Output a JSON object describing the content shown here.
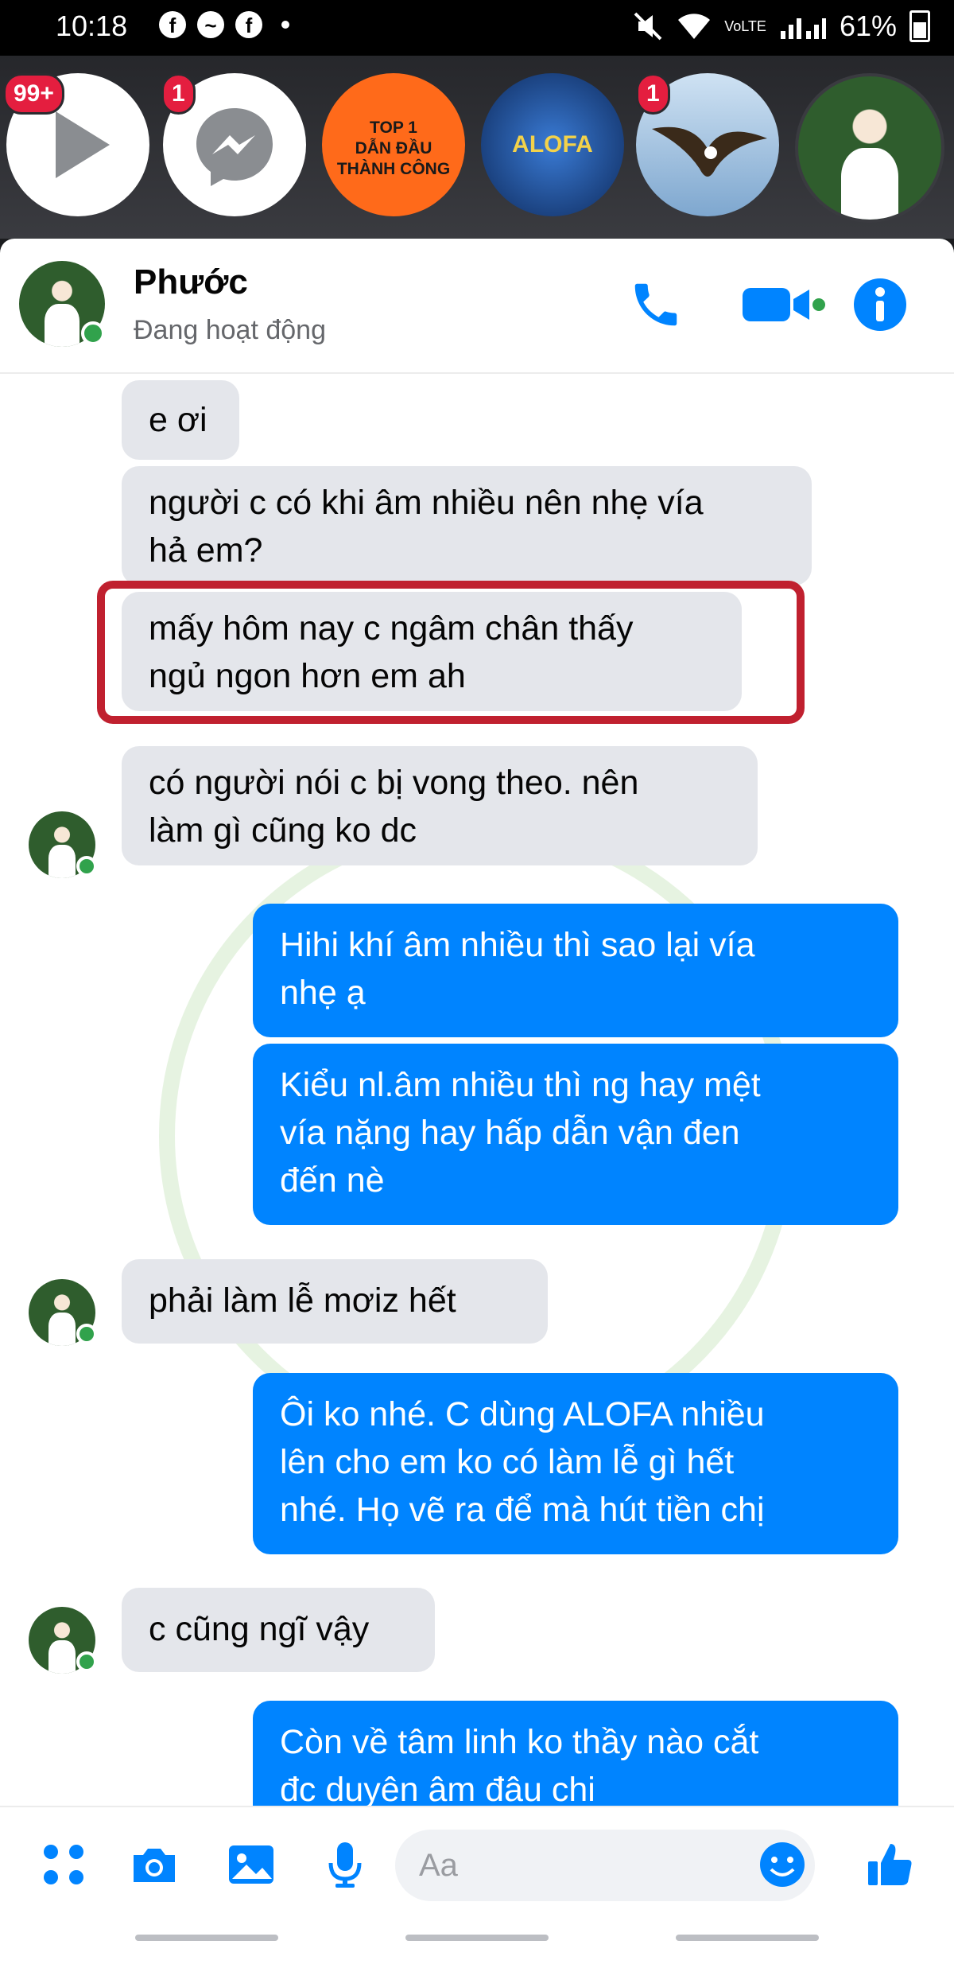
{
  "status": {
    "time": "10:18",
    "battery": "61%",
    "network": "VoLTE"
  },
  "chat_heads": [
    {
      "name": "play-chat-head",
      "badge": "99+",
      "color": "#ffffff"
    },
    {
      "name": "messenger-chat-head",
      "badge": "1",
      "color": "#ffffff"
    },
    {
      "name": "top1-chat-head",
      "lines": [
        "TOP 1",
        "DẪN ĐẦU",
        "THÀNH CÔNG"
      ],
      "color": "#ff6a1a"
    },
    {
      "name": "alofa-chat-head",
      "text": "ALOFA",
      "color": "#1e4a9c"
    },
    {
      "name": "eagle-chat-head",
      "badge": "1",
      "color": "#9fc4e8"
    },
    {
      "name": "contact-chat-head",
      "color": "#2f6a30"
    }
  ],
  "header": {
    "name": "Phước",
    "status": "Đang hoạt động"
  },
  "messages": [
    {
      "side": "in",
      "lines": [
        "e ơi"
      ]
    },
    {
      "side": "in",
      "lines": [
        "người c có khi âm nhiều nên nhẹ vía",
        "hả em?"
      ]
    },
    {
      "side": "in",
      "lines": [
        "mấy hôm nay c ngâm chân thấy",
        "ngủ  ngon hơn em ah"
      ],
      "highlighted": true
    },
    {
      "side": "in",
      "lines": [
        "có người nói c bị  vong theo. nên",
        "làm gì cũng ko dc"
      ]
    },
    {
      "side": "out",
      "lines": [
        "Hihi khí âm nhiều thì sao lại vía",
        "nhẹ ạ"
      ]
    },
    {
      "side": "out",
      "lines": [
        "Kiểu nl.âm nhiều thì ng hay mệt",
        "vía nặng hay hấp dẫn vận đen",
        "đến nè"
      ]
    },
    {
      "side": "in",
      "lines": [
        "phải  làm lễ mơiz hết"
      ]
    },
    {
      "side": "out",
      "lines": [
        "Ôi ko nhé. C dùng ALOFA  nhiều",
        "lên cho em ko có làm lễ gì hết",
        "nhé. Họ vẽ ra để mà hút tiền chị"
      ]
    },
    {
      "side": "in",
      "lines": [
        "c cũng ngĩ vậy"
      ]
    },
    {
      "side": "out",
      "lines": [
        "Còn về tâm linh ko thầy nào cắt",
        "đc duyên âm đâu chi"
      ]
    }
  ],
  "watermark": "ALOFA",
  "composer": {
    "placeholder": "Aa"
  },
  "colors": {
    "accent": "#0084ff",
    "incoming": "#e4e6eb",
    "highlight": "#c0202f",
    "online": "#31a24c"
  }
}
